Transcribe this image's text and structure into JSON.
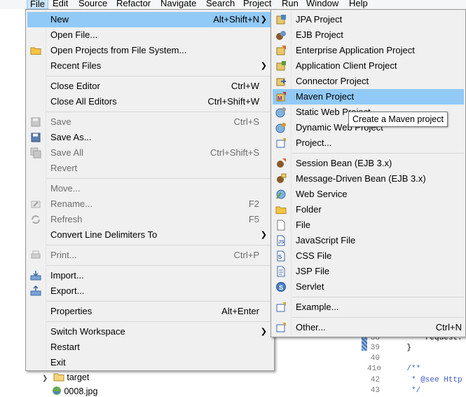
{
  "menubar": {
    "items": [
      "File",
      "Edit",
      "Source",
      "Refactor",
      "Navigate",
      "Search",
      "Project",
      "Run",
      "Window",
      "Help"
    ]
  },
  "file_menu": {
    "new": {
      "label": "New",
      "accel": "Alt+Shift+N"
    },
    "open_file": {
      "label": "Open File..."
    },
    "open_projects": {
      "label": "Open Projects from File System..."
    },
    "recent_files": {
      "label": "Recent Files"
    },
    "close_editor": {
      "label": "Close Editor",
      "accel": "Ctrl+W"
    },
    "close_all_editors": {
      "label": "Close All Editors",
      "accel": "Ctrl+Shift+W"
    },
    "save": {
      "label": "Save",
      "accel": "Ctrl+S"
    },
    "save_as": {
      "label": "Save As..."
    },
    "save_all": {
      "label": "Save All",
      "accel": "Ctrl+Shift+S"
    },
    "revert": {
      "label": "Revert"
    },
    "move": {
      "label": "Move..."
    },
    "rename": {
      "label": "Rename...",
      "accel": "F2"
    },
    "refresh": {
      "label": "Refresh",
      "accel": "F5"
    },
    "convert": {
      "label": "Convert Line Delimiters To"
    },
    "print": {
      "label": "Print...",
      "accel": "Ctrl+P"
    },
    "import": {
      "label": "Import..."
    },
    "export": {
      "label": "Export..."
    },
    "properties": {
      "label": "Properties",
      "accel": "Alt+Enter"
    },
    "switch_workspace": {
      "label": "Switch Workspace"
    },
    "restart": {
      "label": "Restart"
    },
    "exit": {
      "label": "Exit"
    }
  },
  "new_menu": {
    "jpa": "JPA Project",
    "ejb": "EJB Project",
    "enterprise": "Enterprise Application Project",
    "app_client": "Application Client Project",
    "connector": "Connector Project",
    "maven": "Maven Project",
    "static_web": "Static Web Project",
    "dynamic_web": "Dynamic Web Project",
    "project": "Project...",
    "session_bean": "Session Bean (EJB 3.x)",
    "mdb": "Message-Driven Bean (EJB 3.x)",
    "web_service": "Web Service",
    "folder": "Folder",
    "file": "File",
    "js_file": "JavaScript File",
    "css_file": "CSS File",
    "jsp_file": "JSP File",
    "servlet": "Servlet",
    "example": "Example...",
    "other": {
      "label": "Other...",
      "accel": "Ctrl+N"
    }
  },
  "tooltip": "Create a Maven project",
  "editor": {
    "lines": [
      {
        "num": "38",
        "code": "        request."
      },
      {
        "num": "39",
        "code": "    }"
      },
      {
        "num": "40",
        "code": ""
      },
      {
        "num": "41⊖",
        "code": "    /**"
      },
      {
        "num": "42",
        "code": "     * @see Http"
      },
      {
        "num": "43",
        "code": "     */"
      }
    ]
  },
  "tree": {
    "target": "target",
    "jpg": "0008.jpg"
  }
}
